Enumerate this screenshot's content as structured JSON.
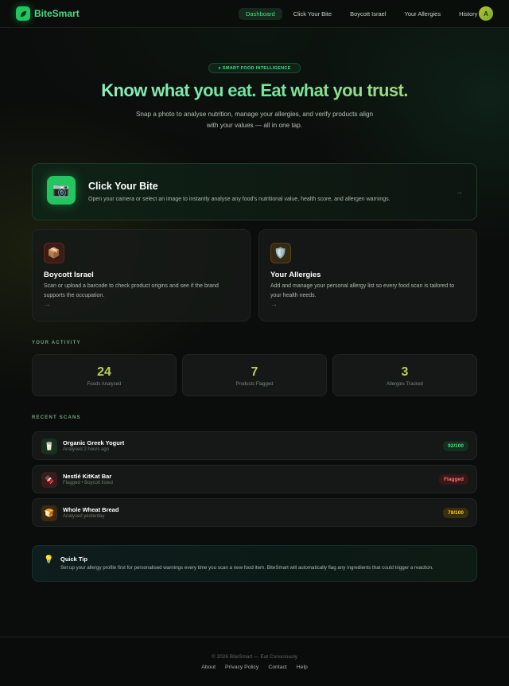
{
  "nav": {
    "brand": "BiteSmart",
    "links": [
      "Dashboard",
      "Click Your Bite",
      "Boycott Israel",
      "Your Allergies",
      "History"
    ],
    "active": "Dashboard",
    "avatar_initial": "A"
  },
  "hero": {
    "badge": "● SMART FOOD INTELLIGENCE",
    "title": "Know what you eat. Eat what you trust.",
    "subtitle": "Snap a photo to analyse nutrition, manage your allergies, and verify products align with your values — all in one tap."
  },
  "features": {
    "main": {
      "title": "Click Your Bite",
      "description": "Open your camera or select an image to instantly analyse any food's nutritional value, health score, and allergen warnings.",
      "icon": "camera-icon",
      "arrow": "→"
    },
    "boycott": {
      "title": "Boycott Israel",
      "description": "Scan or upload a barcode to check product origins and see if the brand supports the occupation.",
      "icon": "package-icon",
      "arrow": "→"
    },
    "allergies": {
      "title": "Your Allergies",
      "description": "Add and manage your personal allergy list so every food scan is tailored to your health needs.",
      "icon": "shield-icon",
      "arrow": "→"
    }
  },
  "activity": {
    "label": "YOUR ACTIVITY",
    "stats": [
      {
        "value": "24",
        "label": "Foods Analysed"
      },
      {
        "value": "7",
        "label": "Products Flagged"
      },
      {
        "value": "3",
        "label": "Allergies Tracked"
      }
    ]
  },
  "recent": {
    "label": "RECENT SCANS",
    "items": [
      {
        "name": "Organic Greek Yogurt",
        "meta": "Analysed 2 hours ago",
        "badge": "92/100",
        "icon": "yogurt-icon",
        "badge_color": "#4ade80"
      },
      {
        "name": "Nestlé KitKat Bar",
        "meta": "Flagged • Boycott listed",
        "badge": "Flagged",
        "icon": "chocolate-icon",
        "badge_color": "#f87171"
      },
      {
        "name": "Whole Wheat Bread",
        "meta": "Analysed yesterday",
        "badge": "78/100",
        "icon": "bread-icon",
        "badge_color": "#facc15"
      }
    ]
  },
  "tip": {
    "title": "Quick Tip",
    "text": "Set up your allergy profile first for personalised warnings every time you scan a new food item. BiteSmart will automatically flag any ingredients that could trigger a reaction.",
    "icon": "lightbulb-icon"
  },
  "footer": {
    "copyright": "© 2026 BiteSmart — Eat Consciously",
    "links": [
      "About",
      "Privacy Policy",
      "Contact",
      "Help"
    ]
  },
  "colors": {
    "accent": "#22c55e",
    "accent_text": "#4ade80",
    "background": "#0b0d0c"
  }
}
